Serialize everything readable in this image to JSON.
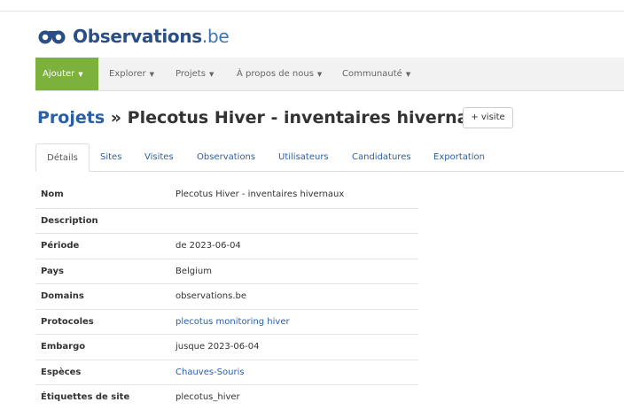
{
  "brand": {
    "name": "Observations",
    "tld": ".be",
    "color": "#2a4f86"
  },
  "nav": {
    "items": [
      {
        "label": "Ajouter",
        "active": true
      },
      {
        "label": "Explorer"
      },
      {
        "label": "Projets"
      },
      {
        "label": "À propos de nous"
      },
      {
        "label": "Communauté"
      }
    ],
    "accent": "#7bb13c"
  },
  "header": {
    "crumb": "Projets",
    "separator": "»",
    "title": "Plecotus Hiver - inventaires hivernaux",
    "visit_button": "+ visite"
  },
  "tabs": [
    "Détails",
    "Sites",
    "Visites",
    "Observations",
    "Utilisateurs",
    "Candidatures",
    "Exportation"
  ],
  "details": [
    {
      "label": "Nom",
      "value": "Plecotus Hiver - inventaires hivernaux"
    },
    {
      "label": "Description",
      "value": ""
    },
    {
      "label": "Période",
      "value": "de 2023-06-04"
    },
    {
      "label": "Pays",
      "value": "Belgium"
    },
    {
      "label": "Domains",
      "value": "observations.be"
    },
    {
      "label": "Protocoles",
      "value": "plecotus monitoring hiver",
      "link": true
    },
    {
      "label": "Embargo",
      "value": "jusque 2023-06-04"
    },
    {
      "label": "Espèces",
      "value": "Chauves-Souris",
      "link": true
    },
    {
      "label": "Étiquettes de site",
      "value": "plecotus_hiver"
    }
  ]
}
